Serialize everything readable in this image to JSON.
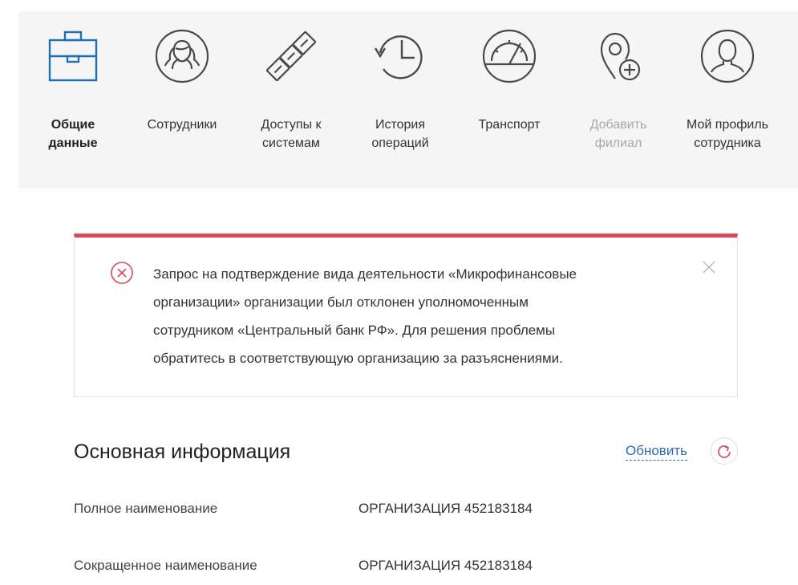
{
  "nav": {
    "items": [
      {
        "label_line1": "Общие",
        "label_line2": "данные",
        "icon": "briefcase-icon",
        "state": "active"
      },
      {
        "label_line1": "Сотрудники",
        "label_line2": "",
        "icon": "employees-icon",
        "state": "normal"
      },
      {
        "label_line1": "Доступы к",
        "label_line2": "системам",
        "icon": "chain-link-icon",
        "state": "normal"
      },
      {
        "label_line1": "История",
        "label_line2": "операций",
        "icon": "history-icon",
        "state": "normal"
      },
      {
        "label_line1": "Транспорт",
        "label_line2": "",
        "icon": "speedometer-icon",
        "state": "normal"
      },
      {
        "label_line1": "Добавить",
        "label_line2": "филиал",
        "icon": "add-location-icon",
        "state": "disabled"
      },
      {
        "label_line1": "Мой профиль",
        "label_line2": "сотрудника",
        "icon": "user-profile-icon",
        "state": "normal"
      }
    ],
    "icon_color": "#4a4a4a",
    "active_icon_color": "#1f6fb5"
  },
  "alert": {
    "lines": [
      "Запрос на подтверждение вида деятельности «Микрофинансовые",
      "организации» организации был отклонен уполномоченным",
      "сотрудником «Центральный банк РФ». Для решения проблемы",
      "обратитесь в соответствующую организацию за разъяснениями."
    ],
    "accent_color": "#d9475d"
  },
  "main_info": {
    "title": "Основная информация",
    "refresh_label": "Обновить",
    "fields": [
      {
        "label": "Полное наименование",
        "value": "ОРГАНИЗАЦИЯ 452183184"
      },
      {
        "label": "Сокращенное наименование",
        "value": "ОРГАНИЗАЦИЯ 452183184"
      }
    ]
  }
}
